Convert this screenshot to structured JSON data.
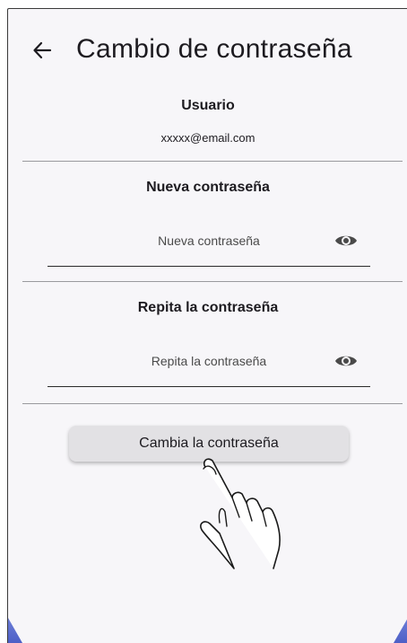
{
  "appbar": {
    "back_icon": "arrow-left-icon",
    "title": "Cambio de contraseña"
  },
  "user": {
    "label": "Usuario",
    "email": "xxxxx@email.com"
  },
  "new_password": {
    "label": "Nueva contraseña",
    "placeholder": "Nueva contraseña",
    "visibility_icon": "eye-icon"
  },
  "repeat_password": {
    "label": "Repita la contraseña",
    "placeholder": "Repita la contraseña",
    "visibility_icon": "eye-icon"
  },
  "submit": {
    "label": "Cambia la contraseña"
  },
  "overlay": {
    "gesture_icon": "tap-hand-icon"
  },
  "colors": {
    "background": "#f7f6f9",
    "button_bg": "#e2e1e4",
    "text": "#1d1b20",
    "accent_corner": "#5b6cd0"
  }
}
